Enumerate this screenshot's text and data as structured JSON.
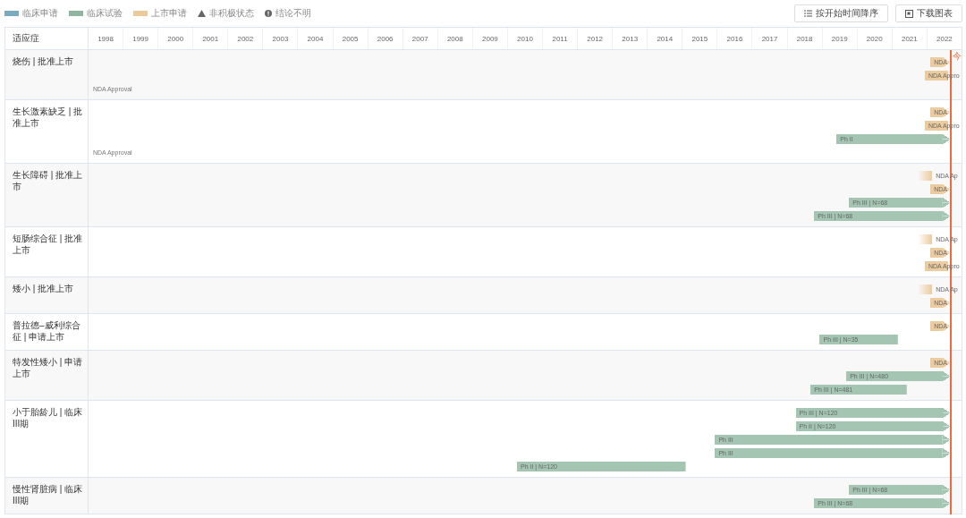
{
  "legend": [
    {
      "kind": "swatch",
      "label": "临床申请",
      "color": "#7aa9c0"
    },
    {
      "kind": "swatch",
      "label": "临床试验",
      "color": "#8fb5a0"
    },
    {
      "kind": "swatch",
      "label": "上市申请",
      "color": "#ecc999"
    },
    {
      "kind": "triangle",
      "label": "非积极状态"
    },
    {
      "kind": "info",
      "label": "结论不明"
    }
  ],
  "toolbar": {
    "sort_button": "按开始时间降序",
    "download_button": "下载图表"
  },
  "table": {
    "header": "适应症",
    "years": [
      "1998",
      "1999",
      "2000",
      "2001",
      "2002",
      "2003",
      "2004",
      "2005",
      "2006",
      "2007",
      "2008",
      "2009",
      "2010",
      "2011",
      "2012",
      "2013",
      "2014",
      "2015",
      "2016",
      "2017",
      "2018",
      "2019",
      "2020",
      "2021",
      "2022"
    ],
    "today_label": "今",
    "rows": [
      {
        "indication": "烧伤 | 批准上市",
        "note": "NDA Approval",
        "bars": [
          {
            "kind": "nda",
            "label": "NDA"
          },
          {
            "kind": "nda",
            "label": "NDA Appro"
          }
        ]
      },
      {
        "indication": "生长激素缺乏 | 批准上市",
        "note": "NDA Approval",
        "bars": [
          {
            "kind": "nda",
            "label": "NDA"
          },
          {
            "kind": "nda",
            "label": "NDA Appro"
          },
          {
            "kind": "trial",
            "label": "Ph II"
          }
        ]
      },
      {
        "indication": "生长障碍 | 批准上市",
        "bars": [
          {
            "kind": "nda",
            "label": "NDA Ap"
          },
          {
            "kind": "nda",
            "label": "NDA"
          },
          {
            "kind": "trial",
            "label": "Ph III | N=68"
          },
          {
            "kind": "trial",
            "label": "Ph III | N=68"
          }
        ]
      },
      {
        "indication": "短肠综合征 | 批准上市",
        "bars": [
          {
            "kind": "nda",
            "label": "NDA Ap"
          },
          {
            "kind": "nda",
            "label": "NDA"
          },
          {
            "kind": "nda",
            "label": "NDA Appro"
          }
        ]
      },
      {
        "indication": "矮小 | 批准上市",
        "bars": [
          {
            "kind": "nda",
            "label": "NDA Ap"
          },
          {
            "kind": "nda",
            "label": "NDA"
          }
        ]
      },
      {
        "indication": "普拉德–威利综合征 | 申请上市",
        "bars": [
          {
            "kind": "nda",
            "label": "NDA"
          },
          {
            "kind": "trial",
            "label": "Ph III | N=35"
          }
        ]
      },
      {
        "indication": "特发性矮小 | 申请上市",
        "bars": [
          {
            "kind": "nda",
            "label": "NDA"
          },
          {
            "kind": "trial",
            "label": "Ph III | N=480"
          },
          {
            "kind": "trial",
            "label": "Ph III | N=481"
          }
        ]
      },
      {
        "indication": "小于胎龄儿 | 临床III期",
        "bars": [
          {
            "kind": "trial",
            "label": "Ph III | N=120"
          },
          {
            "kind": "trial",
            "label": "Ph II | N=120"
          },
          {
            "kind": "trial",
            "label": "Ph III"
          },
          {
            "kind": "trial",
            "label": "Ph III"
          },
          {
            "kind": "trial",
            "label": "Ph II | N=120"
          }
        ]
      },
      {
        "indication": "慢性肾脏病 | 临床III期",
        "bars": [
          {
            "kind": "trial",
            "label": "Ph III | N=68"
          },
          {
            "kind": "trial",
            "label": "Ph III | N=68"
          }
        ]
      }
    ]
  }
}
